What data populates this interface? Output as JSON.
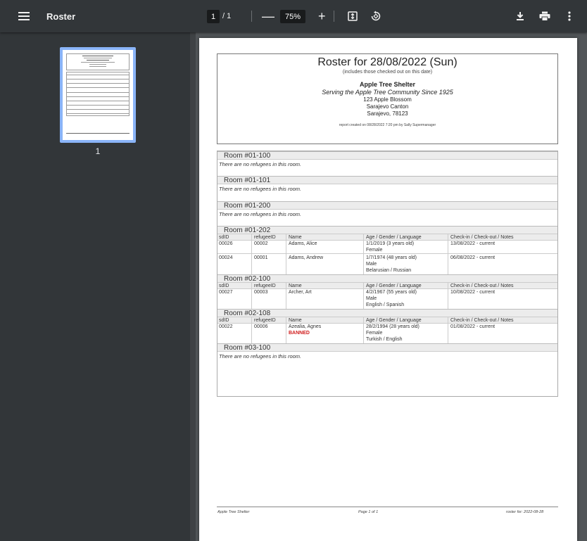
{
  "toolbar": {
    "title": "Roster",
    "current_page": "1",
    "page_total": "/ 1",
    "zoom": "75%",
    "zoom_out": "—",
    "zoom_in": "+"
  },
  "sidebar": {
    "thumbnail_label": "1"
  },
  "document": {
    "title": "Roster for 28/08/2022 (Sun)",
    "subtitle": "(includes those checked out on this date)",
    "shelter_name": "Apple Tree Shelter",
    "tagline": "Serving the Apple Tree Community Since 1925",
    "address": [
      "123 Apple Blossom",
      "Sarajevo Canton",
      "Sarajevo, 78123"
    ],
    "created": "report created on 08/28/2022 7:20 pm by Sally Supermanager",
    "columns": [
      "sdID",
      "refugeeID",
      "Name",
      "Age / Gender / Language",
      "Check-in / Check-out / Notes"
    ],
    "empty_text": "There are no refugees in this room.",
    "rooms": [
      {
        "name": "Room #01-100"
      },
      {
        "name": "Room #01-101"
      },
      {
        "name": "Room #01-200"
      },
      {
        "name": "Room #01-202"
      },
      {
        "name": "Room #02-100"
      },
      {
        "name": "Room #02-108"
      },
      {
        "name": "Room #03-100"
      }
    ],
    "rows": [
      {
        "sdid": "00026",
        "refugeeid": "00002",
        "name": "Adams, Alice",
        "age": "1/1/2019 (3 years old)",
        "gender": "Female",
        "language": "",
        "checkin": "13/08/2022 - current"
      },
      {
        "sdid": "00024",
        "refugeeid": "00001",
        "name": "Adams, Andrew",
        "age": "1/7/1974 (48 years old)",
        "gender": "Male",
        "language": "Belarusian / Russian",
        "checkin": "06/08/2022 - current"
      },
      {
        "sdid": "00027",
        "refugeeid": "00003",
        "name": "Archer, Art",
        "age": "4/2/1967 (55 years old)",
        "gender": "Male",
        "language": "English / Spanish",
        "checkin": "10/08/2022 - current"
      },
      {
        "sdid": "00022",
        "refugeeid": "00006",
        "name": "Azealia, Agnes",
        "banned": "BANNED",
        "age": "28/2/1994 (28 years old)",
        "gender": "Female",
        "language": "Turkish / English",
        "checkin": "01/08/2022 - current"
      }
    ],
    "footer": {
      "left": "Apple Tree Shelter",
      "center": "Page 1 of 1",
      "right": "roster for: 2022-08-28"
    }
  }
}
